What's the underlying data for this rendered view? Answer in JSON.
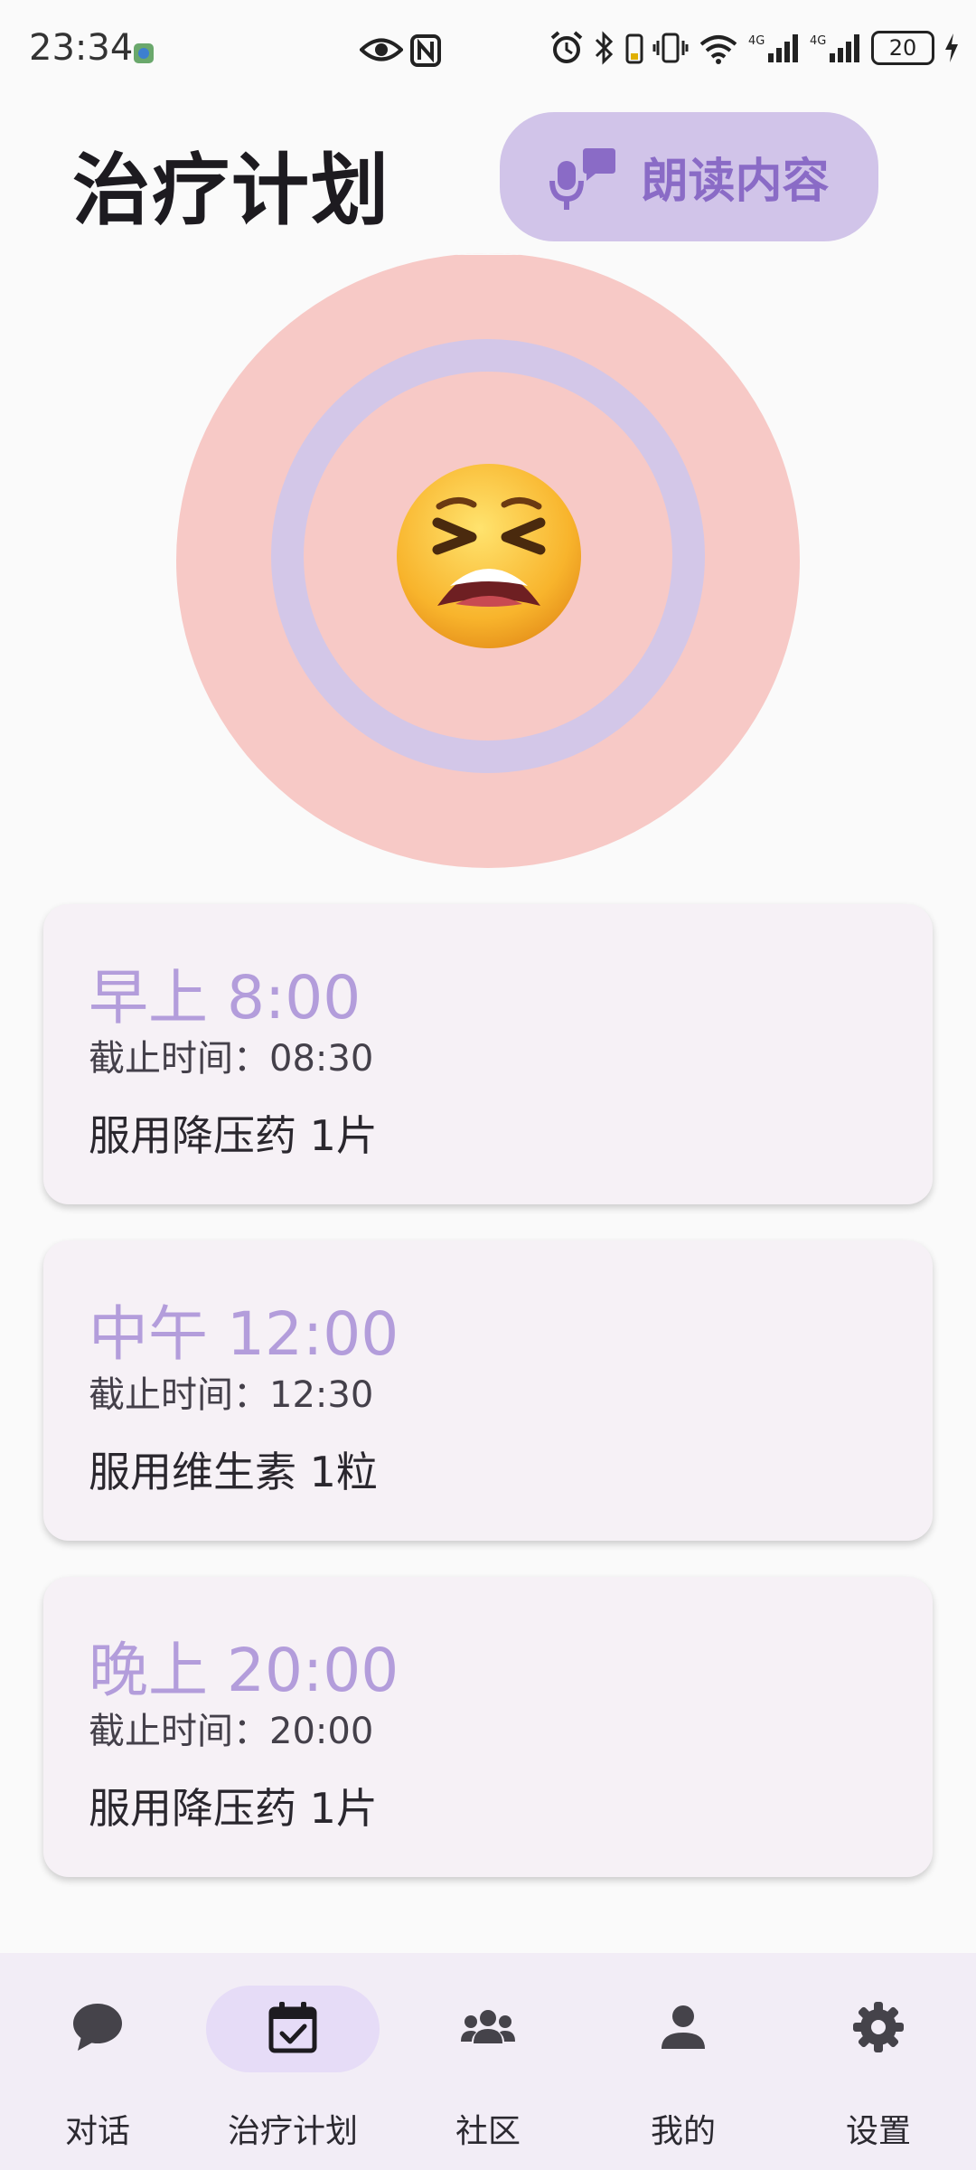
{
  "status_bar": {
    "time": "23:34",
    "network_label": "4G",
    "battery_level": "20"
  },
  "header": {
    "title": "治疗计划",
    "read_button_label": "朗读内容"
  },
  "mood": {
    "emoji": "tired-face",
    "outer_color": "#f7c9c6",
    "ring_color": "#d3c7e8"
  },
  "plans": [
    {
      "time": "早上 8:00",
      "deadline": "截止时间：08:30",
      "task": "服用降压药 1片"
    },
    {
      "time": "中午 12:00",
      "deadline": "截止时间：12:30",
      "task": "服用维生素 1粒"
    },
    {
      "time": "晚上 20:00",
      "deadline": "截止时间：20:00",
      "task": "服用降压药 1片"
    }
  ],
  "nav": {
    "items": [
      {
        "label": "对话",
        "icon": "chat-bubble-icon",
        "active": false
      },
      {
        "label": "治疗计划",
        "icon": "calendar-check-icon",
        "active": true
      },
      {
        "label": "社区",
        "icon": "group-icon",
        "active": false
      },
      {
        "label": "我的",
        "icon": "person-icon",
        "active": false
      },
      {
        "label": "设置",
        "icon": "gear-icon",
        "active": false
      }
    ]
  },
  "colors": {
    "accent": "#b39ddb",
    "button_bg": "#d1c4e9",
    "card_bg": "#f6f1f6",
    "nav_bg": "#f2edf6"
  }
}
